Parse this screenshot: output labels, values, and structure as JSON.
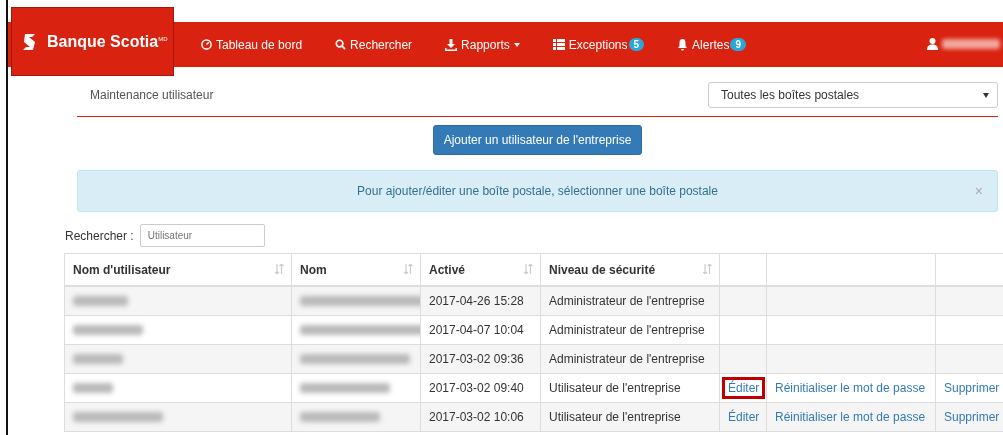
{
  "navbar": {
    "brand": "Banque Scotia",
    "brand_mark": "MD",
    "items": [
      {
        "label": "Tableau de bord",
        "dropdown": false
      },
      {
        "label": "Rechercher",
        "dropdown": false
      },
      {
        "label": "Rapports",
        "dropdown": true
      },
      {
        "label": "Exceptions",
        "badge": "5",
        "dropdown": false
      },
      {
        "label": "Alertes",
        "badge": "9",
        "dropdown": false
      }
    ]
  },
  "page": {
    "title": "Maintenance utilisateur",
    "mailbox_select": "Toutes les boîtes postales",
    "add_button": "Ajouter un utilisateur de l'entreprise",
    "alert": "Pour ajouter/éditer une boîte postale, sélectionner une boîte postale",
    "alert_close": "×"
  },
  "search": {
    "label": "Rechercher :",
    "placeholder": "Utilisateur"
  },
  "table": {
    "columns": [
      {
        "label": "Nom d'utilisateur",
        "sortable": true
      },
      {
        "label": "Nom",
        "sortable": true
      },
      {
        "label": "Activé",
        "sortable": true
      },
      {
        "label": "Niveau de sécurité",
        "sortable": true
      }
    ],
    "rows": [
      {
        "activated": "2017-04-26 15:28",
        "security": "Administrateur de l'entreprise",
        "actions": []
      },
      {
        "activated": "2017-04-07 10:04",
        "security": "Administrateur de l'entreprise",
        "actions": []
      },
      {
        "activated": "2017-03-02 09:36",
        "security": "Administrateur de l'entreprise",
        "actions": []
      },
      {
        "activated": "2017-03-02 09:40",
        "security": "Utilisateur de l'entreprise",
        "actions": [
          {
            "label": "Éditer",
            "highlighted": true
          },
          {
            "label": "Réinitialiser le mot de passe",
            "highlighted": false
          },
          {
            "label": "Supprimer",
            "highlighted": false
          }
        ]
      },
      {
        "activated": "2017-03-02 10:06",
        "security": "Utilisateur de l'entreprise",
        "actions": [
          {
            "label": "Éditer",
            "highlighted": false
          },
          {
            "label": "Réinitialiser le mot de passe",
            "highlighted": false
          },
          {
            "label": "Supprimer",
            "highlighted": false
          }
        ]
      }
    ]
  }
}
